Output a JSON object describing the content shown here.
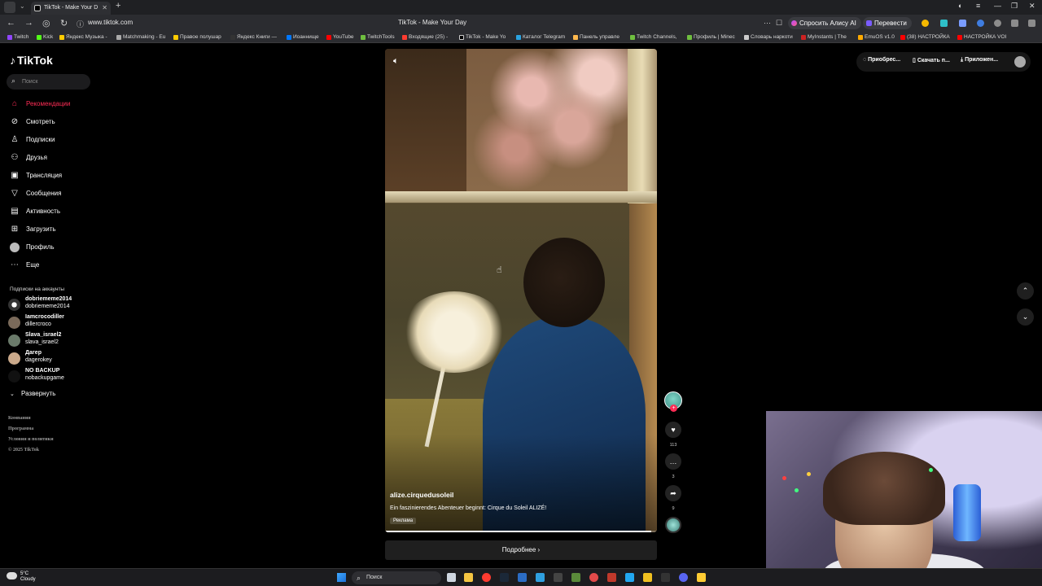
{
  "browser": {
    "tab_title": "TikTok - Make Your D",
    "url": "www.tiktok.com",
    "page_title": "TikTok - Make Your Day",
    "ask_alice": "Спросить Алису AI",
    "translate": "Перевести",
    "bookmarks": [
      "Twitch",
      "Kick",
      "Яндекс Музыка -",
      "Matchmaking - Eu",
      "Правое полушар",
      "Яндекс Книги —",
      "Иоаннище",
      "YouTube",
      "TwitchTools",
      "Входящие (25) -",
      "TikTok - Make Yo",
      "Каталог Telegram",
      "Панель управле",
      "Twitch Channels,",
      "Профиль | Minec",
      "Словарь наркоти",
      "MyInstants | The",
      "EmuOS v1.0",
      "(38) НАСТРОЙКА",
      "НАСТРОЙКА VOI"
    ]
  },
  "tiktok": {
    "logo": "TikTok",
    "search_placeholder": "Поиск",
    "nav": [
      {
        "label": "Рекомендации",
        "icon": "home-icon",
        "active": true
      },
      {
        "label": "Смотреть",
        "icon": "compass-icon"
      },
      {
        "label": "Подписки",
        "icon": "following-icon"
      },
      {
        "label": "Друзья",
        "icon": "friends-icon"
      },
      {
        "label": "Трансляция",
        "icon": "live-icon"
      },
      {
        "label": "Сообщения",
        "icon": "messages-icon"
      },
      {
        "label": "Активность",
        "icon": "activity-icon"
      },
      {
        "label": "Загрузить",
        "icon": "upload-icon"
      },
      {
        "label": "Профиль",
        "icon": "profile-icon"
      },
      {
        "label": "Еще",
        "icon": "more-icon"
      }
    ],
    "following_title": "Подписки на аккаунты",
    "accounts": [
      {
        "name": "dobriememe2014",
        "handle": "dobriememe2014"
      },
      {
        "name": "Iamcrocodiller",
        "handle": "dillercroco"
      },
      {
        "name": "Slava_israel2",
        "handle": "slava_israel2"
      },
      {
        "name": "Дагер",
        "handle": "dagerokey"
      },
      {
        "name": "NO BACKUP",
        "handle": "nobackupgame"
      }
    ],
    "expand": "Развернуть",
    "footer": [
      "Компания",
      "Программа",
      "Условия и политики",
      "© 2025 TikTok"
    ],
    "top_actions": [
      "Приобрес...",
      "Скачать п...",
      "Приложен..."
    ],
    "video": {
      "username": "alize.cirquedusoleil",
      "description": "Ein faszinierendes Abenteuer beginnt: Cirque du Soleil ALIZÉ!",
      "ad_label": "Реклама",
      "progress": 0.98,
      "more_button": "Подробнее"
    },
    "actions": {
      "likes": "113",
      "comments": "3",
      "shares": "9"
    }
  },
  "taskbar": {
    "temp": "5°C",
    "weather": "Cloudy",
    "search": "Поиск"
  }
}
